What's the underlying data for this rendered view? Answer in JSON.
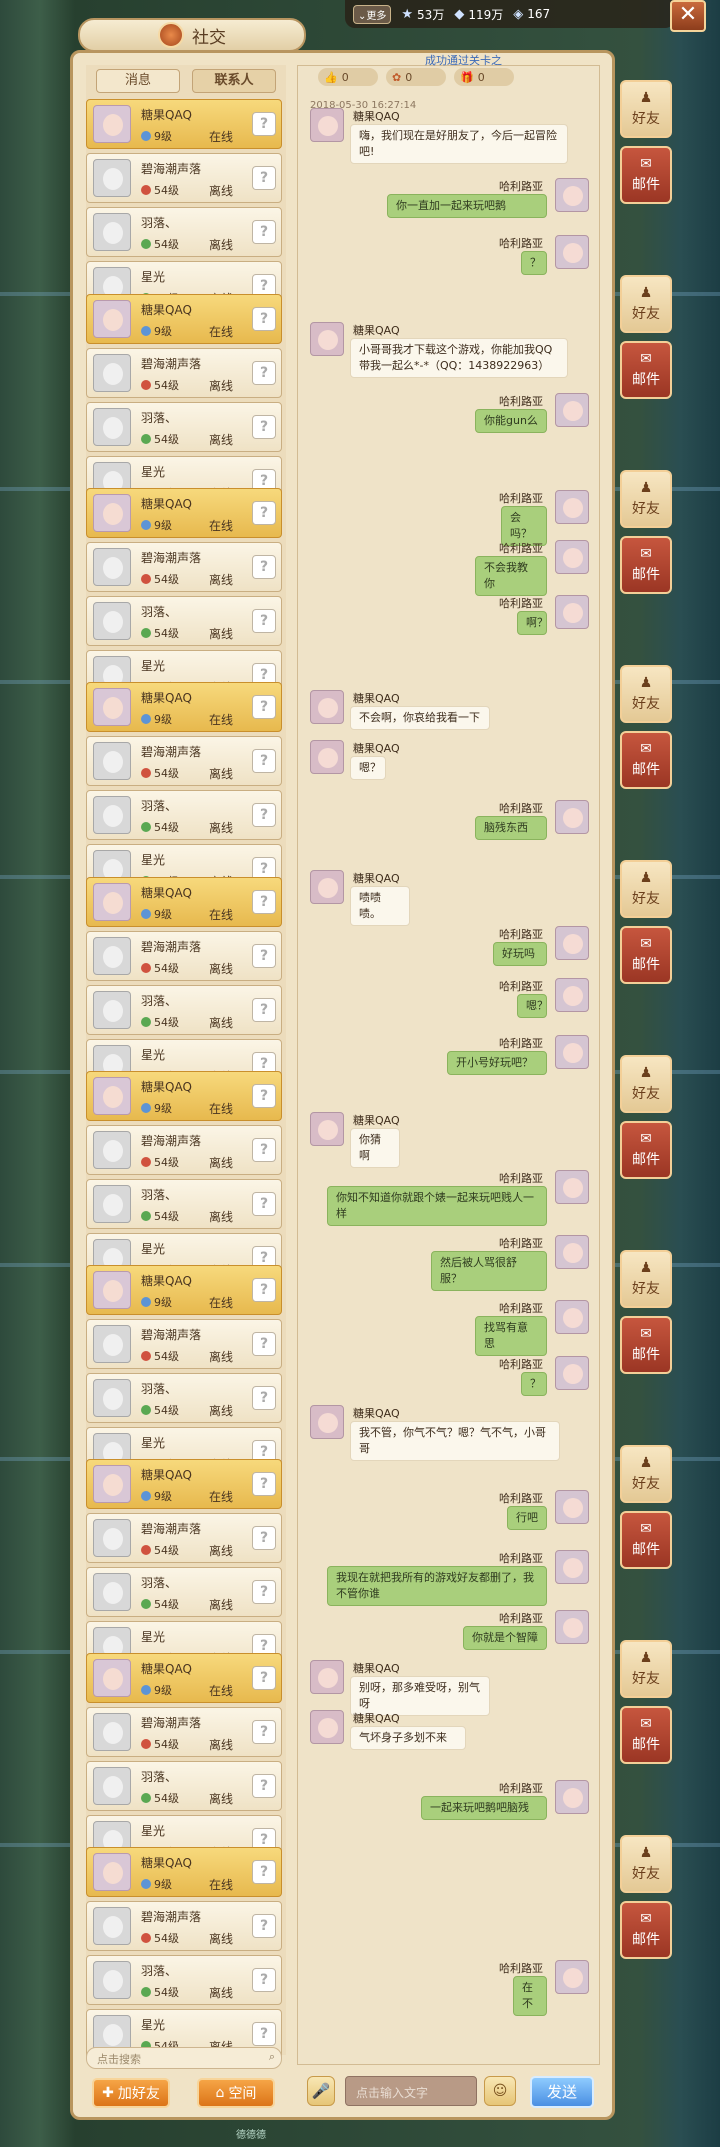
{
  "topbar": {
    "more_label": "更多",
    "stars": "53万",
    "diamonds": "119万",
    "gems": "167",
    "close_symbol": "✕"
  },
  "title": "社交",
  "system_message": "成功通过关卡之",
  "side_tabs": [
    {
      "label": "好友"
    },
    {
      "label": "邮件"
    }
  ],
  "left_tabs": [
    "消息",
    "联系人"
  ],
  "friends": [
    {
      "name": "糖果QAQ",
      "level": "9级",
      "status": "在线"
    },
    {
      "name": "碧海潮声落",
      "level": "54级",
      "status": "离线"
    },
    {
      "name": "羽落、",
      "level": "54级",
      "status": "离线"
    },
    {
      "name": "星光",
      "level": "54级",
      "status": "离线"
    }
  ],
  "search_placeholder": "点击搜索",
  "buttons": {
    "add_friend": "加好友",
    "space": "空间",
    "send": "发送",
    "input_placeholder": "点击输入文字"
  },
  "bottom_label": "德德德",
  "reactions": [
    "0",
    "0",
    "0"
  ],
  "timestamp": "2018-05-30 16:27:14",
  "messages": [
    {
      "from": "糖果QAQ",
      "side": "in",
      "text": "嗨，我们现在是好朋友了，今后一起冒险吧!"
    },
    {
      "from": "哈利路亚",
      "side": "out",
      "text": "你一直加一起来玩吧鹅"
    },
    {
      "from": "哈利路亚",
      "side": "out",
      "text": "？"
    },
    {
      "from": "糖果QAQ",
      "side": "in",
      "text": "小哥哥我才下载这个游戏，你能加我QQ带我一起么*-*（QQ：1438922963）"
    },
    {
      "from": "哈利路亚",
      "side": "out",
      "text": "你能gun么"
    },
    {
      "from": "哈利路亚",
      "side": "out",
      "text": "会吗？"
    },
    {
      "from": "哈利路亚",
      "side": "out",
      "text": "不会我教你"
    },
    {
      "from": "哈利路亚",
      "side": "out",
      "text": "啊？"
    },
    {
      "from": "糖果QAQ",
      "side": "in",
      "text": "不会啊，你哀给我看一下"
    },
    {
      "from": "糖果QAQ",
      "side": "in",
      "text": "嗯？"
    },
    {
      "from": "哈利路亚",
      "side": "out",
      "text": "脑残东西"
    },
    {
      "from": "糖果QAQ",
      "side": "in",
      "text": "啧啧啧。"
    },
    {
      "from": "哈利路亚",
      "side": "out",
      "text": "好玩吗"
    },
    {
      "from": "哈利路亚",
      "side": "out",
      "text": "嗯？"
    },
    {
      "from": "哈利路亚",
      "side": "out",
      "text": "开小号好玩吧？"
    },
    {
      "from": "糖果QAQ",
      "side": "in",
      "text": "你猜啊"
    },
    {
      "from": "哈利路亚",
      "side": "out",
      "text": "你知不知道你就跟个婊一起来玩吧贱人一样"
    },
    {
      "from": "哈利路亚",
      "side": "out",
      "text": "然后被人骂很舒服？"
    },
    {
      "from": "哈利路亚",
      "side": "out",
      "text": "找骂有意思"
    },
    {
      "from": "哈利路亚",
      "side": "out",
      "text": "？"
    },
    {
      "from": "糖果QAQ",
      "side": "in",
      "text": "我不管，你气不气？嗯？气不气，小哥哥"
    },
    {
      "from": "哈利路亚",
      "side": "out",
      "text": "行吧"
    },
    {
      "from": "哈利路亚",
      "side": "out",
      "text": "我现在就把我所有的游戏好友都删了，我不管你谁"
    },
    {
      "from": "哈利路亚",
      "side": "out",
      "text": "你就是个智障"
    },
    {
      "from": "糖果QAQ",
      "side": "in",
      "text": "别呀，那多难受呀，别气呀"
    },
    {
      "from": "糖果QAQ",
      "side": "in",
      "text": "气坏身子多划不来"
    },
    {
      "from": "哈利路亚",
      "side": "out",
      "text": "一起来玩吧鹅吧脑残"
    },
    {
      "from": "哈利路亚",
      "side": "out",
      "text": "在不"
    }
  ]
}
